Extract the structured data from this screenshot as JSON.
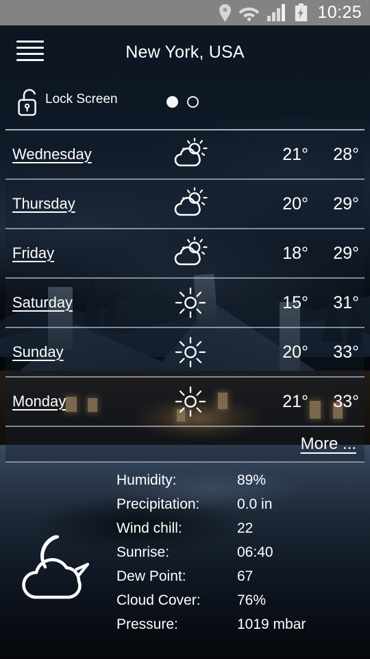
{
  "statusbar": {
    "time": "10:25",
    "icons": [
      "location-pin-icon",
      "wifi-icon",
      "signal-bars-icon",
      "battery-charging-icon"
    ]
  },
  "header": {
    "menu_icon": "hamburger-menu-icon",
    "title": "New York, USA"
  },
  "lock": {
    "icon": "unlocked-padlock-icon",
    "label": "Lock Screen",
    "page_count": 2,
    "active_page": 1
  },
  "forecast": {
    "more_label": "More ...",
    "rows": [
      {
        "day": "Wednesday",
        "icon": "partly-cloudy-icon",
        "low": "21°",
        "high": "28°"
      },
      {
        "day": "Thursday",
        "icon": "partly-cloudy-icon",
        "low": "20°",
        "high": "29°"
      },
      {
        "day": "Friday",
        "icon": "partly-cloudy-icon",
        "low": "18°",
        "high": "29°"
      },
      {
        "day": "Saturday",
        "icon": "sunny-icon",
        "low": "15°",
        "high": "31°"
      },
      {
        "day": "Sunday",
        "icon": "sunny-icon",
        "low": "20°",
        "high": "33°"
      },
      {
        "day": "Monday",
        "icon": "sunny-icon",
        "low": "21°",
        "high": "33°"
      }
    ]
  },
  "details": {
    "condition_icon": "moon-behind-cloud-icon",
    "rows": [
      {
        "label": "Humidity:",
        "value": "89%"
      },
      {
        "label": "Precipitation:",
        "value": "0.0 in"
      },
      {
        "label": "Wind chill:",
        "value": "22"
      },
      {
        "label": "Sunrise:",
        "value": "06:40"
      },
      {
        "label": "Dew Point:",
        "value": "67"
      },
      {
        "label": "Cloud Cover:",
        "value": "76%"
      },
      {
        "label": "Pressure:",
        "value": "1019 mbar"
      }
    ]
  },
  "colors": {
    "statusbar_bg": "#838383",
    "text": "#ffffff",
    "panel_bg": "rgba(18,28,42,.42)",
    "divider": "rgba(200,212,224,.62)"
  }
}
